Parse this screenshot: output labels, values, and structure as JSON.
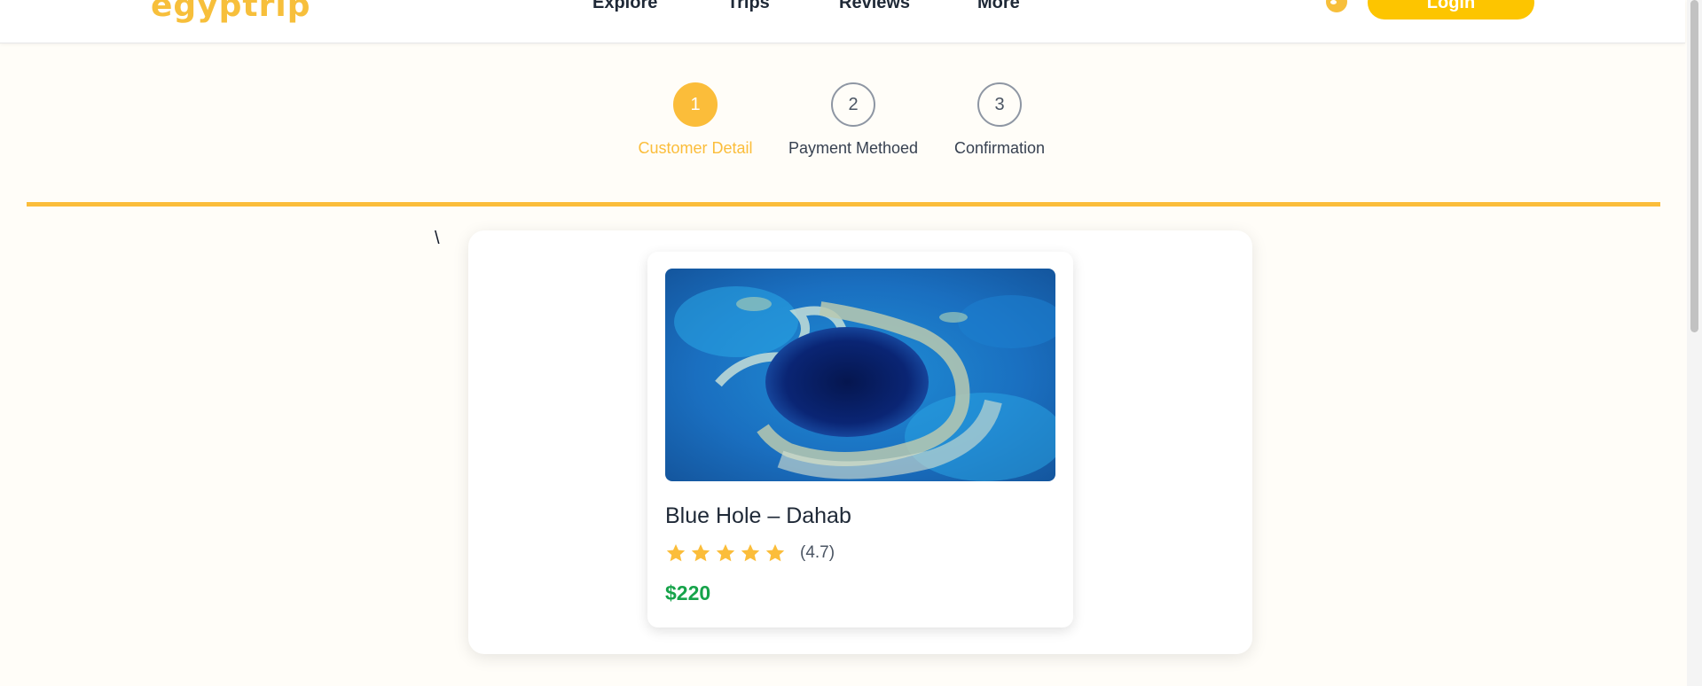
{
  "header": {
    "logo_text": "egyptrip",
    "nav": [
      "Explore",
      "Trips",
      "Reviews",
      "More"
    ],
    "login_label": "Login",
    "globe_icon": "globe-icon"
  },
  "stepper": {
    "steps": [
      {
        "number": "1",
        "label": "Customer Detail",
        "active": true
      },
      {
        "number": "2",
        "label": "Payment Methoed",
        "active": false
      },
      {
        "number": "3",
        "label": "Confirmation",
        "active": false
      }
    ]
  },
  "stray_text": "\\",
  "card": {
    "title": "Blue Hole – Dahab",
    "stars": 5,
    "rating": "(4.7)",
    "price": "$220"
  },
  "colors": {
    "accent": "#fbbd3a",
    "login_button": "#fdc500",
    "price": "#16a34a",
    "background": "#fffdf8"
  }
}
